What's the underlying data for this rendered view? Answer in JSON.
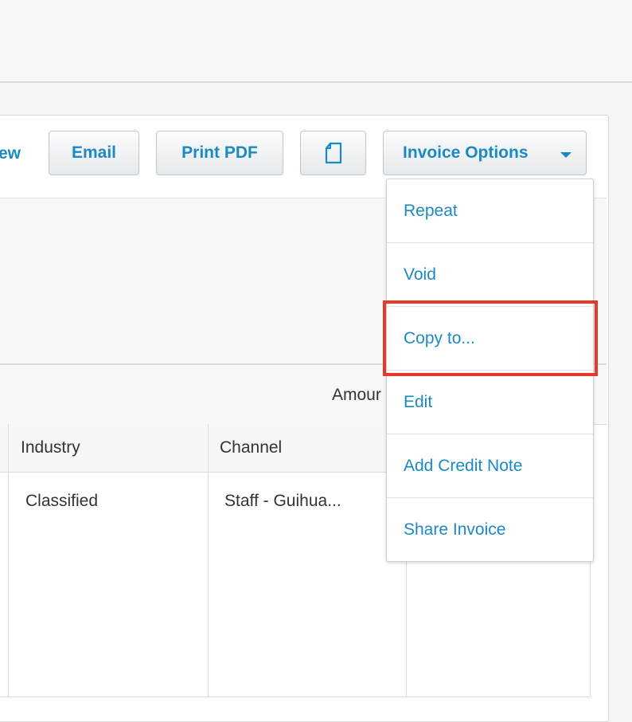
{
  "toolbar": {
    "view_link_fragment": "ew",
    "email_label": "Email",
    "print_pdf_label": "Print PDF",
    "document_icon": "document-icon",
    "invoice_options_label": "Invoice Options"
  },
  "summary": {
    "amount_label_fragment": "Amour"
  },
  "table": {
    "columns": [
      "Industry",
      "Channel"
    ],
    "rows": [
      {
        "industry": "Classified",
        "channel": "Staff - Guihua..."
      }
    ]
  },
  "invoice_options_menu": {
    "items": [
      {
        "label": "Repeat"
      },
      {
        "label": "Void"
      },
      {
        "label": "Copy to..."
      },
      {
        "label": "Edit"
      },
      {
        "label": "Add Credit Note"
      },
      {
        "label": "Share Invoice"
      }
    ],
    "highlighted_item": "Copy to...",
    "highlight_color": "#e8372c"
  },
  "colors": {
    "link_blue": "#1b8ac4",
    "text": "#333333",
    "border": "#dcdcdc"
  }
}
